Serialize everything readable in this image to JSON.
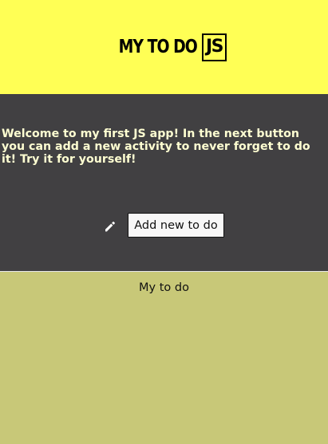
{
  "header": {
    "title": "MY TO DO",
    "badge": "JS"
  },
  "intro": {
    "text": "Welcome to my first JS app! In the next button you can add a new activity to never forget to do it! Try it for yourself!",
    "icon": "pencil-icon",
    "button_label": "Add new to do"
  },
  "todo": {
    "heading": "My to do",
    "items": []
  },
  "colors": {
    "header_bg": "#ffff55",
    "intro_bg": "#414042",
    "intro_text": "#ffffd2",
    "todo_bg": "#c8c878"
  }
}
